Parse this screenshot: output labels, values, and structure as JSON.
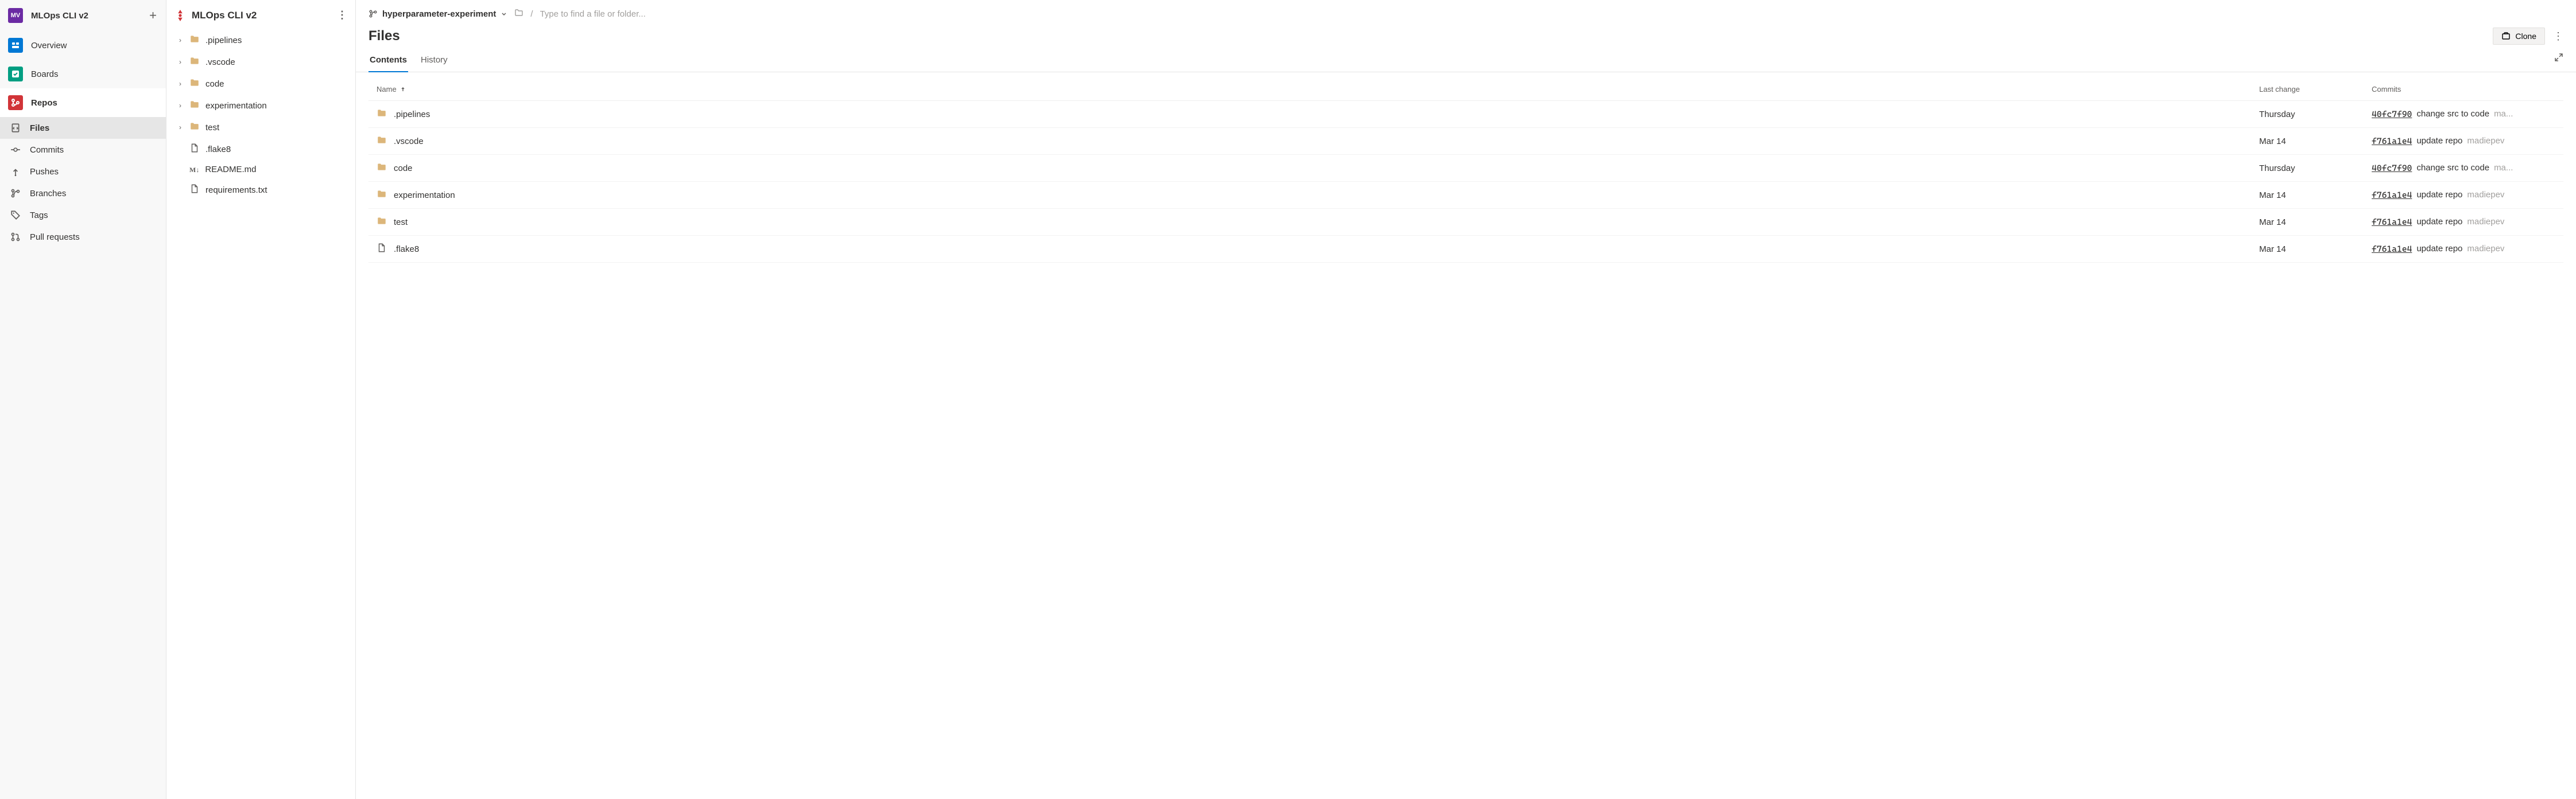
{
  "project": {
    "badge": "MV",
    "name": "MLOps CLI v2"
  },
  "leftnav": {
    "items": [
      {
        "key": "overview",
        "label": "Overview"
      },
      {
        "key": "boards",
        "label": "Boards"
      },
      {
        "key": "repos",
        "label": "Repos",
        "active": true
      }
    ],
    "repos_sub": [
      {
        "key": "files",
        "label": "Files",
        "active": true
      },
      {
        "key": "commits",
        "label": "Commits"
      },
      {
        "key": "pushes",
        "label": "Pushes"
      },
      {
        "key": "branches",
        "label": "Branches"
      },
      {
        "key": "tags",
        "label": "Tags"
      },
      {
        "key": "pulls",
        "label": "Pull requests"
      }
    ]
  },
  "tree": {
    "repo_name": "MLOps CLI v2",
    "nodes": [
      {
        "name": ".pipelines",
        "type": "folder"
      },
      {
        "name": ".vscode",
        "type": "folder"
      },
      {
        "name": "code",
        "type": "folder"
      },
      {
        "name": "experimentation",
        "type": "folder"
      },
      {
        "name": "test",
        "type": "folder"
      },
      {
        "name": ".flake8",
        "type": "file"
      },
      {
        "name": "README.md",
        "type": "md"
      },
      {
        "name": "requirements.txt",
        "type": "file"
      }
    ]
  },
  "main": {
    "branch": "hyperparameter-experiment",
    "path_placeholder": "Type to find a file or folder...",
    "page_title": "Files",
    "clone_label": "Clone",
    "tabs": [
      {
        "label": "Contents",
        "active": true
      },
      {
        "label": "History"
      }
    ],
    "columns": {
      "name": "Name",
      "last_change": "Last change",
      "commits": "Commits"
    },
    "rows": [
      {
        "name": ".pipelines",
        "type": "folder",
        "last_change": "Thursday",
        "hash": "40fc7f90",
        "msg": "change src to code",
        "author": "ma..."
      },
      {
        "name": ".vscode",
        "type": "folder",
        "last_change": "Mar 14",
        "hash": "f761a1e4",
        "msg": "update repo",
        "author": "madiepev"
      },
      {
        "name": "code",
        "type": "folder",
        "last_change": "Thursday",
        "hash": "40fc7f90",
        "msg": "change src to code",
        "author": "ma..."
      },
      {
        "name": "experimentation",
        "type": "folder",
        "last_change": "Mar 14",
        "hash": "f761a1e4",
        "msg": "update repo",
        "author": "madiepev"
      },
      {
        "name": "test",
        "type": "folder",
        "last_change": "Mar 14",
        "hash": "f761a1e4",
        "msg": "update repo",
        "author": "madiepev"
      },
      {
        "name": ".flake8",
        "type": "file",
        "last_change": "Mar 14",
        "hash": "f761a1e4",
        "msg": "update repo",
        "author": "madiepev"
      }
    ]
  }
}
